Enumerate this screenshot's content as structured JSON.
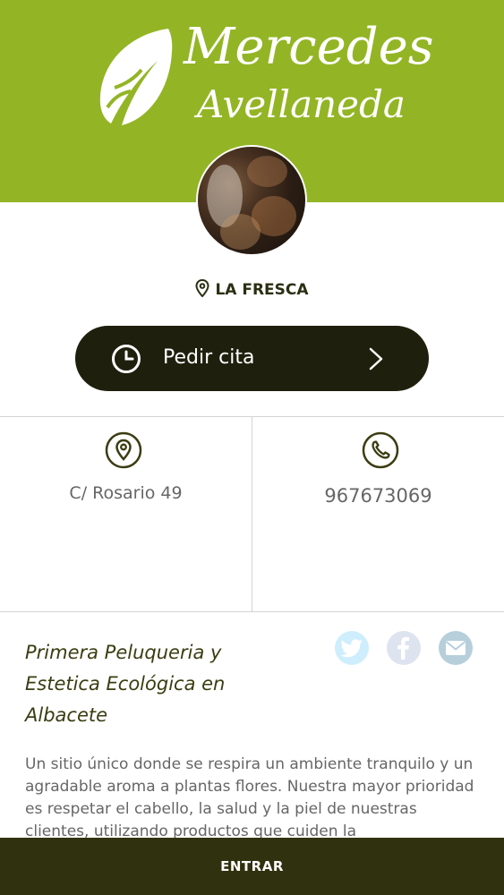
{
  "brand": {
    "line1": "Mercedes",
    "line2": "Avellaneda",
    "color": "#93b525"
  },
  "location": {
    "icon": "map-pin-icon",
    "label": "LA FRESCA"
  },
  "cta": {
    "icon": "clock-icon",
    "label": "Pedir cita",
    "chevron": "chevron-right-icon",
    "color": "#1f1f0d"
  },
  "contact": {
    "address": {
      "icon": "map-pin-icon",
      "text": "C/ Rosario 49"
    },
    "phone": {
      "icon": "phone-icon",
      "text": "967673069"
    }
  },
  "tagline": "Primera Peluqueria y Estetica Ecológica en Albacete",
  "share": [
    {
      "icon": "twitter-icon",
      "color": "#cfeefd"
    },
    {
      "icon": "facebook-icon",
      "color": "#dde3ef"
    },
    {
      "icon": "email-icon",
      "color": "#b6cfdb"
    }
  ],
  "description": "Un sitio único donde se respira un ambiente tranquilo y un agradable aroma a plantas flores. Nuestra mayor prioridad es respetar el cabello, la salud y la piel de nuestras clientes, utilizando productos que cuiden la",
  "footer": {
    "label": "ENTRAR",
    "color": "#30320f"
  }
}
